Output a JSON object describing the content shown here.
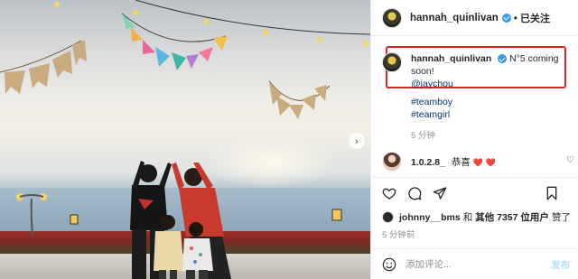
{
  "post": {
    "photo": {
      "alt_icon": "chevron-right-icon"
    },
    "header": {
      "username": "hannah_quinlivan",
      "separator": "•",
      "follow_status": "已关注"
    },
    "caption": {
      "username": "hannah_quinlivan",
      "text": "N°5 coming soon!",
      "mention": "@jaychou",
      "hashtags": [
        "#teamboy",
        "#teamgirl"
      ],
      "time": "5 分钟"
    },
    "comment": {
      "username": "1.0.2.8_",
      "text": "恭喜",
      "hearts": "❤️ ❤️"
    },
    "likes": {
      "first_user": "johnny__bms",
      "connector": "和",
      "others": "其他 7357 位用户",
      "suffix": "赞了"
    },
    "post_time": "5 分钟前",
    "comment_bar": {
      "placeholder": "添加评论...",
      "post_label": "发布"
    }
  }
}
